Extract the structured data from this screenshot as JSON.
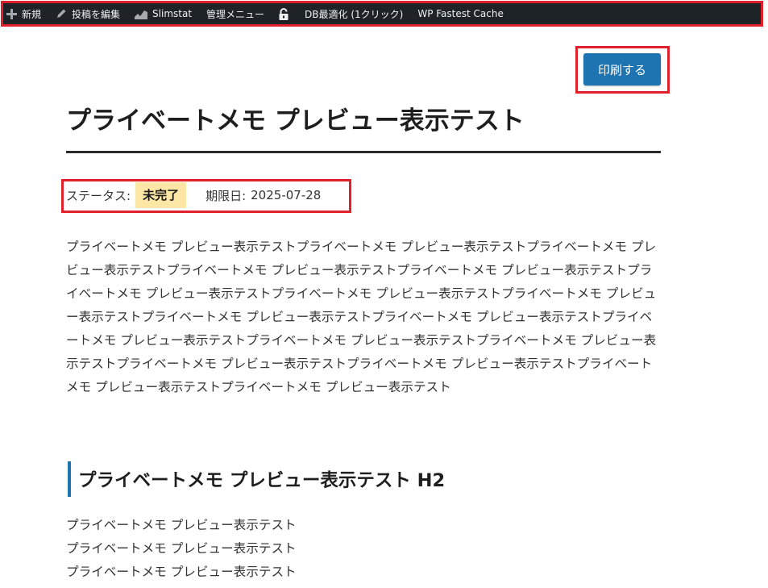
{
  "admin_bar": {
    "items": [
      {
        "label": "新規",
        "icon": "plus-icon"
      },
      {
        "label": "投稿を編集",
        "icon": "pencil-icon"
      },
      {
        "label": "Slimstat",
        "icon": "chart-icon"
      },
      {
        "label": "管理メニュー",
        "icon": ""
      },
      {
        "label": "",
        "icon": "lock-icon"
      },
      {
        "label": "DB最適化 (1クリック)",
        "icon": ""
      },
      {
        "label": "WP Fastest Cache",
        "icon": ""
      }
    ],
    "background": "#1d2327"
  },
  "print_button": {
    "label": "印刷する",
    "color": "#1e74b0"
  },
  "page_title": "プライベートメモ プレビュー表示テスト",
  "status": {
    "label": "ステータス:",
    "value": "未完了",
    "badge_color": "#fde7a6",
    "due_label": "期限日:",
    "due_date": "2025-07-28"
  },
  "body_text": "プライベートメモ プレビュー表示テストプライベートメモ プレビュー表示テストプライベートメモ プレビュー表示テストプライベートメモ プレビュー表示テストプライベートメモ プレビュー表示テストプライベートメモ プレビュー表示テストプライベートメモ プレビュー表示テストプライベートメモ プレビュー表示テストプライベートメモ プレビュー表示テストプライベートメモ プレビュー表示テストプライベートメモ プレビュー表示テストプライベートメモ プレビュー表示テストプライベートメモ プレビュー表示テストプライベートメモ プレビュー表示テストプライベートメモ プレビュー表示テストプライベートメモ プレビュー表示テストプライベートメモ プレビュー表示テスト",
  "section": {
    "heading": "プライベートメモ プレビュー表示テスト H2",
    "accent": "#1e74b0",
    "lines": [
      "プライベートメモ プレビュー表示テスト",
      "プライベートメモ プレビュー表示テスト",
      "プライベートメモ プレビュー表示テスト"
    ]
  },
  "highlight_color": "#e0202a"
}
